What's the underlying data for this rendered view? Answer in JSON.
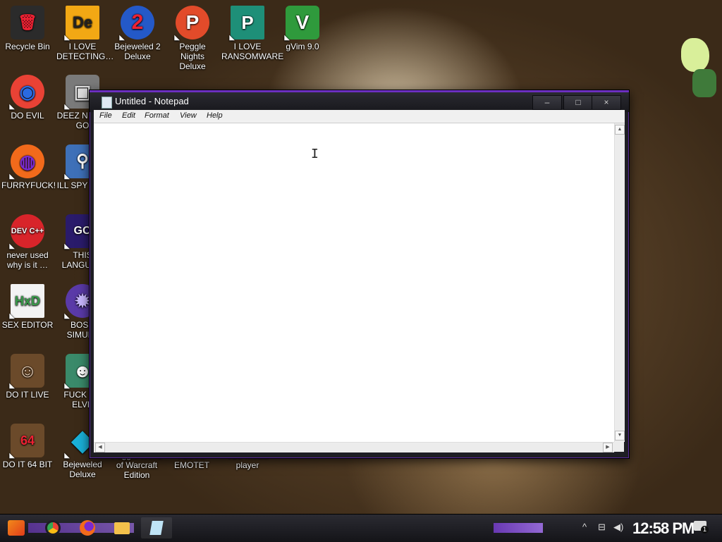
{
  "desktop": {
    "icons": [
      {
        "label": "Recycle Bin",
        "glyph": "🗑",
        "bg": "#2b2b2b"
      },
      {
        "label": "I LOVE DETECTING…",
        "glyph": "De",
        "bg": "#f2a814"
      },
      {
        "label": "Bejeweled 2 Deluxe",
        "glyph": "2",
        "bg": "#2459c8"
      },
      {
        "label": "Peggle Nights Deluxe",
        "glyph": "P",
        "bg": "#e24b2a"
      },
      {
        "label": "I LOVE RANSOMWARE",
        "glyph": "P",
        "bg": "#1e8f78"
      },
      {
        "label": "gVim 9.0",
        "glyph": "V",
        "bg": "#2f9a3c"
      },
      {
        "label": "DO EVIL",
        "glyph": "◉",
        "bg": "#e94235"
      },
      {
        "label": "DEEZ N HAH GO",
        "glyph": "▣",
        "bg": "#7a7a7a"
      },
      {
        "label": "FURRYFUCK!",
        "glyph": "◍",
        "bg": "#f26a1b"
      },
      {
        "label": "ILL SPY YOU",
        "glyph": "⚲",
        "bg": "#3e70b8"
      },
      {
        "label": "never used why is it …",
        "glyph": "DEV C++",
        "bg": "#d8242a"
      },
      {
        "label": "THIS LANGUAG",
        "glyph": "GO",
        "bg": "#2a1b6b"
      },
      {
        "label": "SEX EDITOR",
        "glyph": "HxD",
        "bg": "#f3f3f3"
      },
      {
        "label": "BOSN SIMULA",
        "glyph": "✹",
        "bg": "#5a3aa8"
      },
      {
        "label": "DO IT LIVE",
        "glyph": "☺",
        "bg": "#6b4a2a"
      },
      {
        "label": "FUCK SO ELVE",
        "glyph": "☻",
        "bg": "#3a8a6a"
      },
      {
        "label": "DO IT 64 BIT",
        "glyph": "64",
        "bg": "#6b4a2a"
      },
      {
        "label": "Bejeweled Deluxe",
        "glyph": "◆",
        "bg": "#1ab0d8"
      },
      {
        "label": "Peggle World of Warcraft Edition",
        "glyph": "",
        "bg": "transparent"
      },
      {
        "label": "I LOVE EMOTET",
        "glyph": "",
        "bg": "transparent"
      },
      {
        "label": "VLC media player",
        "glyph": "",
        "bg": "transparent"
      }
    ]
  },
  "notepad": {
    "title": "Untitled - Notepad",
    "controls": {
      "minimize": "–",
      "maximize": "□",
      "close": "×"
    },
    "menu": [
      "File",
      "Edit",
      "Format",
      "View",
      "Help"
    ],
    "content": ""
  },
  "taskbar": {
    "clock": "12:58 PM",
    "tray_arrow": "^",
    "network_icon": "⊟",
    "volume_icon": "◀)",
    "notifications_badge": "1"
  },
  "colors": {
    "accent": "#7b3fd6"
  }
}
